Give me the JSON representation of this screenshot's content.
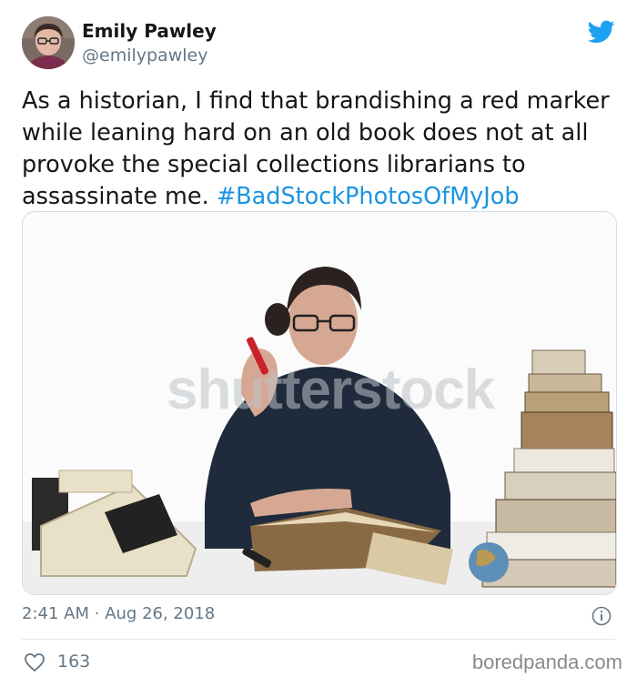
{
  "tweet": {
    "author_name": "Emily Pawley",
    "author_handle": "@emilypawley",
    "text_main": "As a historian, I find that brandishing a red marker while leaning hard on an old book does not at all provoke the special collections librarians to assassinate me.",
    "hashtag": "#BadStockPhotosOfMyJob",
    "time": "2:41 AM",
    "separator": "·",
    "date": "Aug 26, 2018",
    "like_count": "163"
  },
  "media": {
    "watermark_text": "shutterstock"
  },
  "footer": {
    "site_watermark": "boredpanda.com"
  },
  "colors": {
    "brand_blue": "#1da1f2",
    "hashtag_blue": "#1b95e0",
    "secondary_text": "#657786"
  },
  "icons": [
    "twitter-bird-icon",
    "info-icon",
    "heart-icon"
  ]
}
